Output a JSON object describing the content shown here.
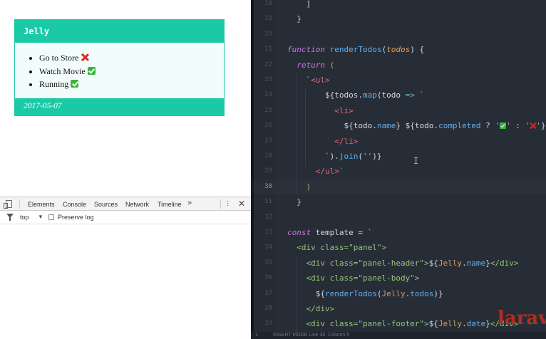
{
  "browser": {
    "panel": {
      "header": "Jelly",
      "todos": [
        {
          "name": "Go to Store",
          "completed": false,
          "mark": "cross-icon"
        },
        {
          "name": "Watch Movie",
          "completed": true,
          "mark": "check-icon"
        },
        {
          "name": "Running",
          "completed": true,
          "mark": "check-icon"
        }
      ],
      "footer": "2017-05-07",
      "colors": {
        "accent": "#1ac9a5",
        "body_bg": "#f2fcfa"
      }
    }
  },
  "devtools": {
    "tabs": [
      "Elements",
      "Console",
      "Sources",
      "Network",
      "Timeline"
    ],
    "active_tab": "Console",
    "more": "»",
    "close": "✕",
    "context": "top",
    "context_arrow": "▼",
    "preserve_log": "Preserve log"
  },
  "editor": {
    "lines": [
      {
        "n": "18",
        "text": "    ]"
      },
      {
        "n": "19",
        "text": "  }"
      },
      {
        "n": "20",
        "text": ""
      },
      {
        "n": "21",
        "text": "  function renderTodos(todos) {"
      },
      {
        "n": "22",
        "text": "    return ("
      },
      {
        "n": "23",
        "text": "      `<ul>"
      },
      {
        "n": "24",
        "text": "        ${todos.map(todo => `"
      },
      {
        "n": "25",
        "text": "          <li>"
      },
      {
        "n": "26",
        "text": "            ${todo.name} ${todo.completed ? '' : ''}"
      },
      {
        "n": "27",
        "text": "          </li>"
      },
      {
        "n": "28",
        "text": "        `).join('')}"
      },
      {
        "n": "29",
        "text": "      </ul>`"
      },
      {
        "n": "30",
        "text": "    )"
      },
      {
        "n": "31",
        "text": "  }"
      },
      {
        "n": "32",
        "text": ""
      },
      {
        "n": "33",
        "text": "  const template = `"
      },
      {
        "n": "34",
        "text": "    <div class=\"panel\">"
      },
      {
        "n": "35",
        "text": "      <div class=\"panel-header\">${Jelly.name}</div>"
      },
      {
        "n": "36",
        "text": "      <div class=\"panel-body\">"
      },
      {
        "n": "37",
        "text": "        ${renderTodos(Jelly.todos)}"
      },
      {
        "n": "38",
        "text": "      </div>"
      },
      {
        "n": "39",
        "text": "      <div class=\"panel-footer\">${Jelly.date}</div>"
      }
    ],
    "current_line": "30",
    "status": {
      "line_label": "1",
      "text": "INSERT MODE  Line 30, Column 5"
    },
    "watermark": "laravist"
  }
}
